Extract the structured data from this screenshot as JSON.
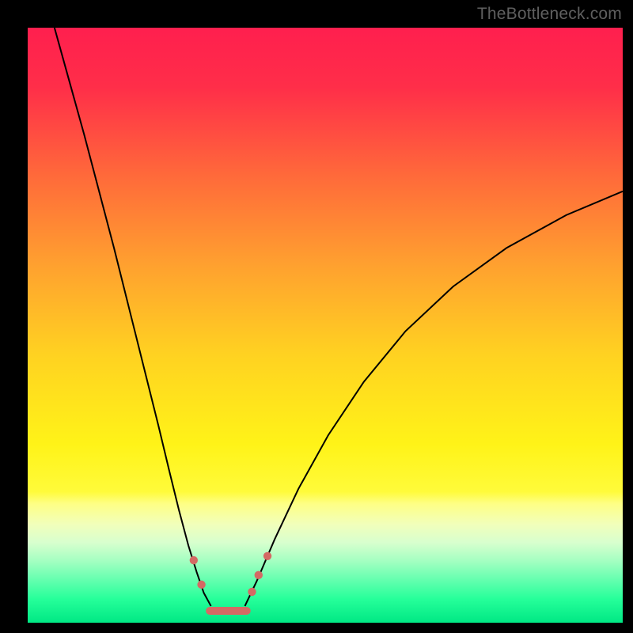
{
  "watermark": "TheBottleneck.com",
  "chart_data": {
    "type": "line",
    "title": "",
    "xlabel": "",
    "ylabel": "",
    "xlim": [
      0,
      100
    ],
    "ylim": [
      0,
      100
    ],
    "gradient_stops": [
      {
        "offset": 0.0,
        "color": "#ff1f4e"
      },
      {
        "offset": 0.1,
        "color": "#ff2e49"
      },
      {
        "offset": 0.25,
        "color": "#ff6a3a"
      },
      {
        "offset": 0.4,
        "color": "#ffa12f"
      },
      {
        "offset": 0.55,
        "color": "#ffd221"
      },
      {
        "offset": 0.7,
        "color": "#fff318"
      },
      {
        "offset": 0.78,
        "color": "#fffb3a"
      },
      {
        "offset": 0.8,
        "color": "#feff85"
      },
      {
        "offset": 0.835,
        "color": "#f1ffbb"
      },
      {
        "offset": 0.865,
        "color": "#d8ffce"
      },
      {
        "offset": 0.895,
        "color": "#a6ffc2"
      },
      {
        "offset": 0.925,
        "color": "#6affb1"
      },
      {
        "offset": 0.96,
        "color": "#26ff9a"
      },
      {
        "offset": 1.0,
        "color": "#00e884"
      }
    ],
    "series": [
      {
        "name": "left-curve",
        "color": "#000000",
        "width": 2,
        "x": [
          4.5,
          7.0,
          9.5,
          12.0,
          14.5,
          17.0,
          19.5,
          22.0,
          23.8,
          25.4,
          27.0,
          28.4,
          29.6,
          30.8
        ],
        "y": [
          100,
          91.0,
          82.0,
          72.5,
          63.0,
          53.0,
          43.0,
          33.0,
          25.5,
          19.0,
          13.0,
          8.5,
          5.0,
          2.8
        ]
      },
      {
        "name": "right-curve",
        "color": "#000000",
        "width": 2,
        "x": [
          36.5,
          38.5,
          41.5,
          45.5,
          50.5,
          56.5,
          63.5,
          71.5,
          80.5,
          90.5,
          100.0
        ],
        "y": [
          2.8,
          7.0,
          14.0,
          22.5,
          31.5,
          40.5,
          49.0,
          56.5,
          63.0,
          68.5,
          72.5
        ]
      },
      {
        "name": "trough-band",
        "color": "#d46a64",
        "width": 10,
        "cap": "round",
        "x": [
          30.6,
          36.8
        ],
        "y": [
          2.0,
          2.0
        ]
      }
    ],
    "markers": {
      "color": "#d46a64",
      "radius": 5.2,
      "points": [
        {
          "x": 27.9,
          "y": 10.5
        },
        {
          "x": 29.2,
          "y": 6.4
        },
        {
          "x": 37.7,
          "y": 5.2
        },
        {
          "x": 38.8,
          "y": 8.0
        },
        {
          "x": 40.3,
          "y": 11.2
        }
      ]
    }
  }
}
